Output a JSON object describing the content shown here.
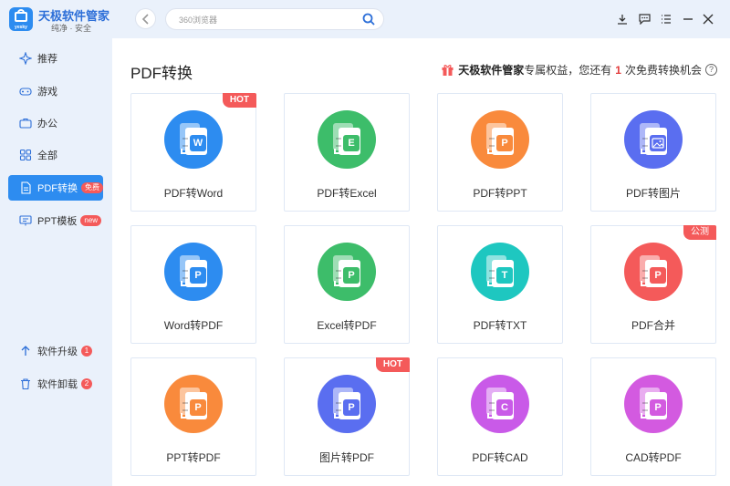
{
  "app": {
    "name": "天极软件管家",
    "slogan": "纯净 · 安全",
    "logo_text": "yesky"
  },
  "search": {
    "placeholder": "360浏览器"
  },
  "sidebar": {
    "items": [
      {
        "label": "推荐"
      },
      {
        "label": "游戏"
      },
      {
        "label": "办公"
      },
      {
        "label": "全部"
      },
      {
        "label": "PDF转换",
        "badge": "免费"
      },
      {
        "label": "PPT模板",
        "badge": "new"
      }
    ],
    "bottom": [
      {
        "label": "软件升级",
        "count": "1"
      },
      {
        "label": "软件卸载",
        "count": "2"
      }
    ]
  },
  "main": {
    "title": "PDF转换",
    "rights": {
      "brand": "天极软件管家",
      "text1": "专属权益，您还有",
      "count": "1",
      "text2": "次免费转换机会",
      "help": "?"
    },
    "cards": [
      {
        "label": "PDF转Word",
        "tag": "HOT",
        "color": "#2d8cf0",
        "mark": "W"
      },
      {
        "label": "PDF转Excel",
        "tag": "",
        "color": "#3dbd6a",
        "mark": "E"
      },
      {
        "label": "PDF转PPT",
        "tag": "",
        "color": "#f98a3c",
        "mark": "P"
      },
      {
        "label": "PDF转图片",
        "tag": "",
        "color": "#5a6ef0",
        "mark": "img"
      },
      {
        "label": "Word转PDF",
        "tag": "",
        "color": "#2d8cf0",
        "mark": "P"
      },
      {
        "label": "Excel转PDF",
        "tag": "",
        "color": "#3dbd6a",
        "mark": "P"
      },
      {
        "label": "PDF转TXT",
        "tag": "",
        "color": "#1ec7c0",
        "mark": "T"
      },
      {
        "label": "PDF合并",
        "tag": "公测",
        "color": "#f45a5a",
        "mark": "P"
      },
      {
        "label": "PPT转PDF",
        "tag": "",
        "color": "#f98a3c",
        "mark": "P"
      },
      {
        "label": "图片转PDF",
        "tag": "HOT",
        "color": "#5a6ef0",
        "mark": "P"
      },
      {
        "label": "PDF转CAD",
        "tag": "",
        "color": "#c95ae8",
        "mark": "C"
      },
      {
        "label": "CAD转PDF",
        "tag": "",
        "color": "#d35ae0",
        "mark": "P"
      }
    ]
  }
}
